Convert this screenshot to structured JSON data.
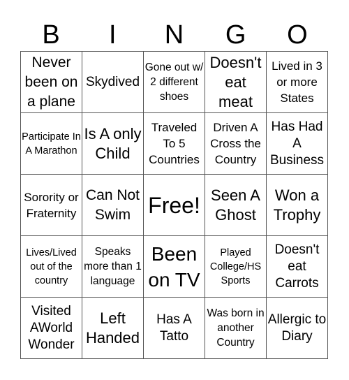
{
  "title_letters": [
    "B",
    "I",
    "N",
    "G",
    "O"
  ],
  "cells": [
    [
      "Never been on a plane",
      "Skydived",
      "Gone out w/ 2 different shoes",
      "Doesn't eat meat",
      "Lived in 3 or more States"
    ],
    [
      "Participate In A Marathon",
      "Is A only Child",
      "Traveled To 5 Countries",
      "Driven A Cross the Country",
      "Has Had A Business"
    ],
    [
      "Sorority or Fraternity",
      "Can Not Swim",
      "Free!",
      "Seen A Ghost",
      "Won a Trophy"
    ],
    [
      "Lives/Lived out of the country",
      "Speaks more than 1 language",
      "Been on TV",
      "Played College/HS Sports",
      "Doesn't eat Carrots"
    ],
    [
      "Visited AWorld Wonder",
      "Left Handed",
      "Has A Tatto",
      "Was born in another Country",
      "Allergic to Diary"
    ]
  ]
}
